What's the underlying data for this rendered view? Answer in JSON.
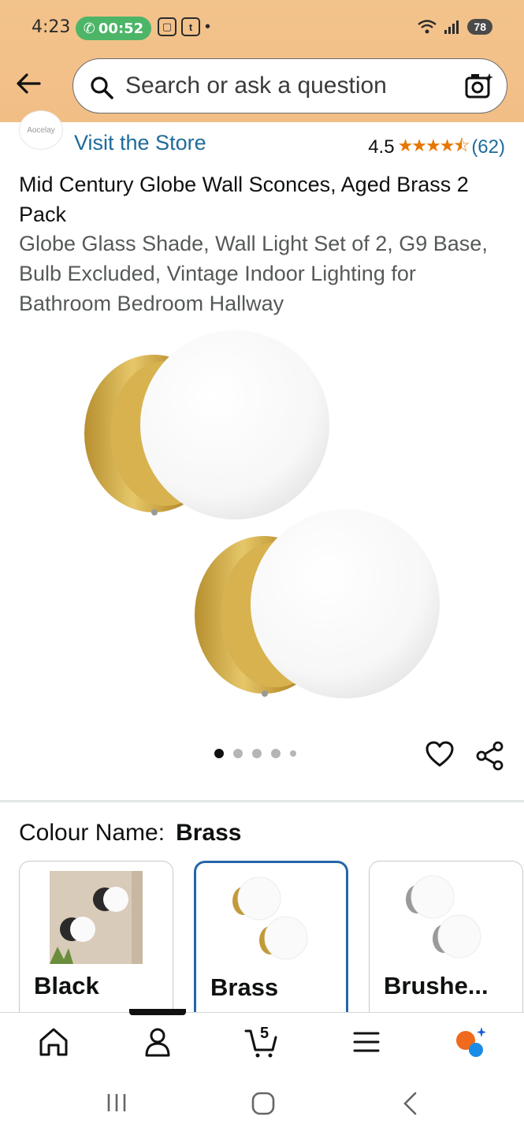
{
  "status_bar": {
    "time": "4:23",
    "call_timer": "00:52",
    "battery": "78"
  },
  "header": {
    "search_placeholder": "Search or ask a question"
  },
  "store": {
    "logo_text": "Aocelay",
    "visit_label": "Visit the Store",
    "rating": "4.5",
    "rating_count": "(62)"
  },
  "product": {
    "title": "Mid Century Globe Wall Sconces, Aged Brass 2 Pack",
    "subtitle": "Globe Glass Shade, Wall Light Set of 2, G9 Base, Bulb Excluded, Vintage Indoor Lighting for Bathroom Bedroom Hallway",
    "image_count": 5,
    "active_image": 1
  },
  "variation": {
    "label": "Colour Name:",
    "selected": "Brass",
    "options": [
      {
        "label": "Black"
      },
      {
        "label": "Brass"
      },
      {
        "label": "Brushe..."
      }
    ]
  },
  "tabbar": {
    "cart_count": "5"
  },
  "colors": {
    "header_bg": "#f1be86",
    "link": "#1e6b9b",
    "star": "#e77600",
    "selected_border": "#2466a8"
  }
}
